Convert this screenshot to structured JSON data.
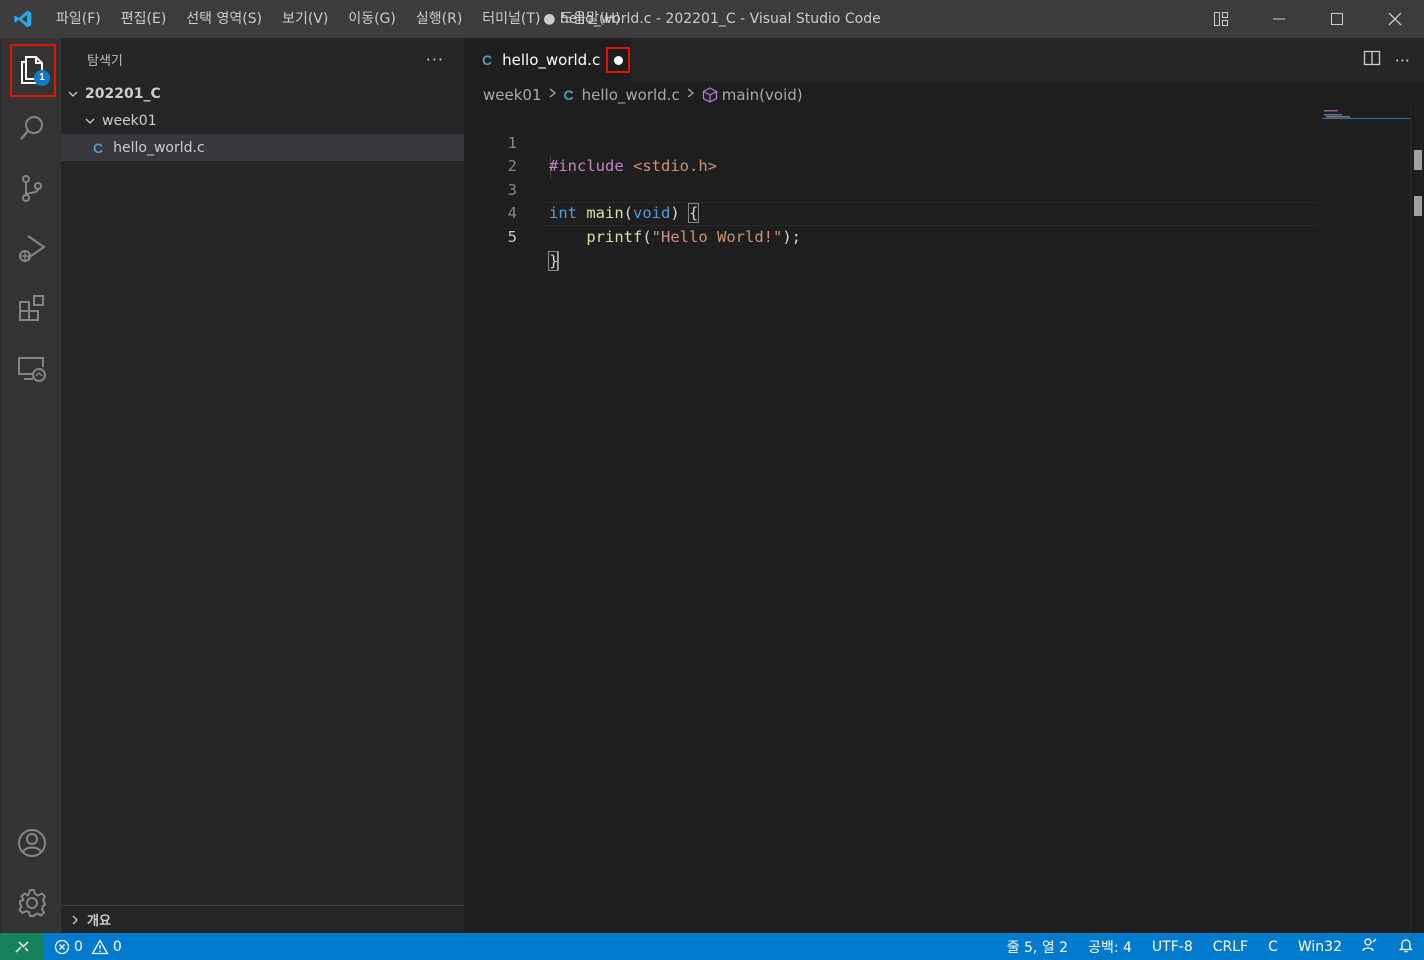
{
  "menu": [
    "파일(F)",
    "편집(E)",
    "선택 영역(S)",
    "보기(V)",
    "이동(G)",
    "실행(R)",
    "터미널(T)",
    "도움말(H)"
  ],
  "window_title": "● hello_world.c - 202201_C - Visual Studio Code",
  "activity": {
    "explorer_badge": "1"
  },
  "sidebar": {
    "title": "탐색기",
    "more": "···",
    "tree": {
      "root": "202201_C",
      "folder": "week01",
      "file_glyph": "C",
      "file": "hello_world.c"
    },
    "outline": "개요"
  },
  "editor": {
    "tab": {
      "glyph": "C",
      "name": "hello_world.c"
    },
    "more": "···",
    "breadcrumb": {
      "folder": "week01",
      "glyph": "C",
      "file": "hello_world.c",
      "symbol": "main(void)"
    },
    "lines": [
      {
        "num": "1",
        "include": "#include",
        "header": "<stdio.h>"
      },
      {
        "num": "2"
      },
      {
        "num": "3",
        "type": "int",
        "name": "main",
        "open": "(",
        "arg": "void",
        "close": ")",
        "brace": "{"
      },
      {
        "num": "4",
        "indent": "    ",
        "fn": "printf",
        "open": "(",
        "str": "\"Hello World!\"",
        "close": ");"
      },
      {
        "num": "5",
        "brace": "}"
      }
    ]
  },
  "status": {
    "errors": "0",
    "warnings": "0",
    "position": "줄 5, 열 2",
    "spaces": "공백: 4",
    "encoding": "UTF-8",
    "eol": "CRLF",
    "language": "C",
    "platform": "Win32"
  },
  "colors": {
    "statusbar": "#007acc",
    "remote": "#16825d",
    "highlight": "#e51400",
    "badge": "#0e7acc"
  }
}
